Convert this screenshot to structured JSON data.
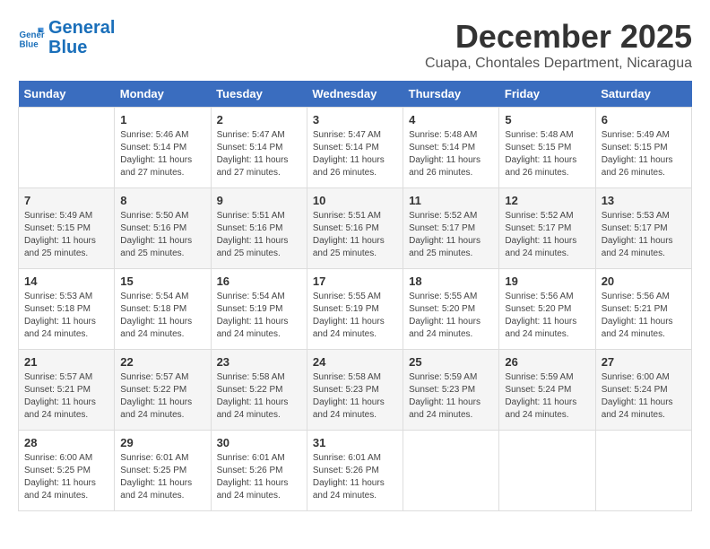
{
  "logo": {
    "line1": "General",
    "line2": "Blue"
  },
  "title": "December 2025",
  "subtitle": "Cuapa, Chontales Department, Nicaragua",
  "header": {
    "days": [
      "Sunday",
      "Monday",
      "Tuesday",
      "Wednesday",
      "Thursday",
      "Friday",
      "Saturday"
    ]
  },
  "weeks": [
    [
      {
        "day": "",
        "info": ""
      },
      {
        "day": "1",
        "info": "Sunrise: 5:46 AM\nSunset: 5:14 PM\nDaylight: 11 hours\nand 27 minutes."
      },
      {
        "day": "2",
        "info": "Sunrise: 5:47 AM\nSunset: 5:14 PM\nDaylight: 11 hours\nand 27 minutes."
      },
      {
        "day": "3",
        "info": "Sunrise: 5:47 AM\nSunset: 5:14 PM\nDaylight: 11 hours\nand 26 minutes."
      },
      {
        "day": "4",
        "info": "Sunrise: 5:48 AM\nSunset: 5:14 PM\nDaylight: 11 hours\nand 26 minutes."
      },
      {
        "day": "5",
        "info": "Sunrise: 5:48 AM\nSunset: 5:15 PM\nDaylight: 11 hours\nand 26 minutes."
      },
      {
        "day": "6",
        "info": "Sunrise: 5:49 AM\nSunset: 5:15 PM\nDaylight: 11 hours\nand 26 minutes."
      }
    ],
    [
      {
        "day": "7",
        "info": "Sunrise: 5:49 AM\nSunset: 5:15 PM\nDaylight: 11 hours\nand 25 minutes."
      },
      {
        "day": "8",
        "info": "Sunrise: 5:50 AM\nSunset: 5:16 PM\nDaylight: 11 hours\nand 25 minutes."
      },
      {
        "day": "9",
        "info": "Sunrise: 5:51 AM\nSunset: 5:16 PM\nDaylight: 11 hours\nand 25 minutes."
      },
      {
        "day": "10",
        "info": "Sunrise: 5:51 AM\nSunset: 5:16 PM\nDaylight: 11 hours\nand 25 minutes."
      },
      {
        "day": "11",
        "info": "Sunrise: 5:52 AM\nSunset: 5:17 PM\nDaylight: 11 hours\nand 25 minutes."
      },
      {
        "day": "12",
        "info": "Sunrise: 5:52 AM\nSunset: 5:17 PM\nDaylight: 11 hours\nand 24 minutes."
      },
      {
        "day": "13",
        "info": "Sunrise: 5:53 AM\nSunset: 5:17 PM\nDaylight: 11 hours\nand 24 minutes."
      }
    ],
    [
      {
        "day": "14",
        "info": "Sunrise: 5:53 AM\nSunset: 5:18 PM\nDaylight: 11 hours\nand 24 minutes."
      },
      {
        "day": "15",
        "info": "Sunrise: 5:54 AM\nSunset: 5:18 PM\nDaylight: 11 hours\nand 24 minutes."
      },
      {
        "day": "16",
        "info": "Sunrise: 5:54 AM\nSunset: 5:19 PM\nDaylight: 11 hours\nand 24 minutes."
      },
      {
        "day": "17",
        "info": "Sunrise: 5:55 AM\nSunset: 5:19 PM\nDaylight: 11 hours\nand 24 minutes."
      },
      {
        "day": "18",
        "info": "Sunrise: 5:55 AM\nSunset: 5:20 PM\nDaylight: 11 hours\nand 24 minutes."
      },
      {
        "day": "19",
        "info": "Sunrise: 5:56 AM\nSunset: 5:20 PM\nDaylight: 11 hours\nand 24 minutes."
      },
      {
        "day": "20",
        "info": "Sunrise: 5:56 AM\nSunset: 5:21 PM\nDaylight: 11 hours\nand 24 minutes."
      }
    ],
    [
      {
        "day": "21",
        "info": "Sunrise: 5:57 AM\nSunset: 5:21 PM\nDaylight: 11 hours\nand 24 minutes."
      },
      {
        "day": "22",
        "info": "Sunrise: 5:57 AM\nSunset: 5:22 PM\nDaylight: 11 hours\nand 24 minutes."
      },
      {
        "day": "23",
        "info": "Sunrise: 5:58 AM\nSunset: 5:22 PM\nDaylight: 11 hours\nand 24 minutes."
      },
      {
        "day": "24",
        "info": "Sunrise: 5:58 AM\nSunset: 5:23 PM\nDaylight: 11 hours\nand 24 minutes."
      },
      {
        "day": "25",
        "info": "Sunrise: 5:59 AM\nSunset: 5:23 PM\nDaylight: 11 hours\nand 24 minutes."
      },
      {
        "day": "26",
        "info": "Sunrise: 5:59 AM\nSunset: 5:24 PM\nDaylight: 11 hours\nand 24 minutes."
      },
      {
        "day": "27",
        "info": "Sunrise: 6:00 AM\nSunset: 5:24 PM\nDaylight: 11 hours\nand 24 minutes."
      }
    ],
    [
      {
        "day": "28",
        "info": "Sunrise: 6:00 AM\nSunset: 5:25 PM\nDaylight: 11 hours\nand 24 minutes."
      },
      {
        "day": "29",
        "info": "Sunrise: 6:01 AM\nSunset: 5:25 PM\nDaylight: 11 hours\nand 24 minutes."
      },
      {
        "day": "30",
        "info": "Sunrise: 6:01 AM\nSunset: 5:26 PM\nDaylight: 11 hours\nand 24 minutes."
      },
      {
        "day": "31",
        "info": "Sunrise: 6:01 AM\nSunset: 5:26 PM\nDaylight: 11 hours\nand 24 minutes."
      },
      {
        "day": "",
        "info": ""
      },
      {
        "day": "",
        "info": ""
      },
      {
        "day": "",
        "info": ""
      }
    ]
  ]
}
